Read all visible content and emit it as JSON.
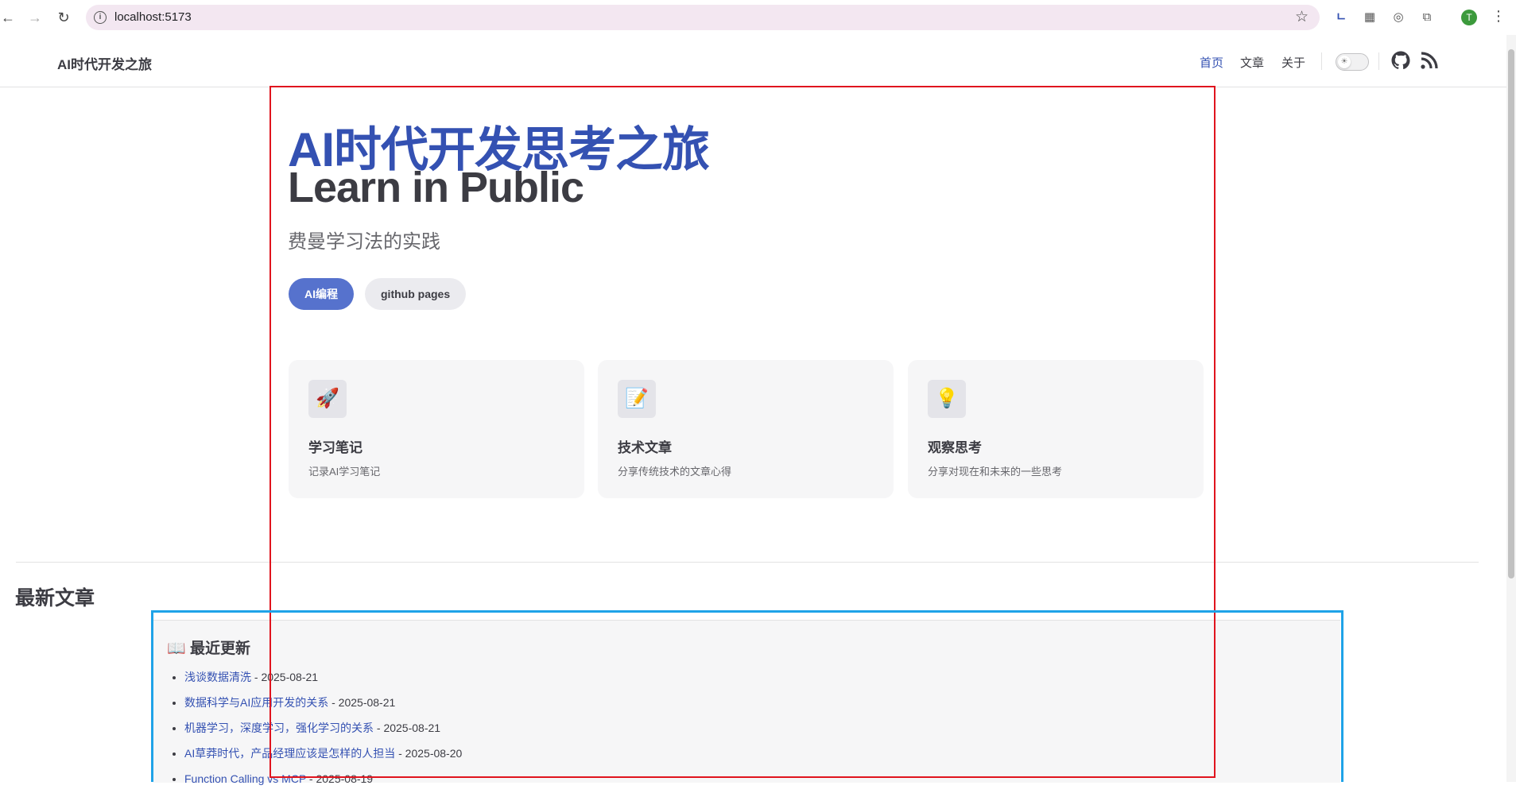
{
  "browser": {
    "url": "localhost:5173",
    "avatar_letter": "T"
  },
  "nav": {
    "brand": "AI时代开发之旅",
    "links": [
      {
        "label": "首页",
        "active": true
      },
      {
        "label": "文章",
        "active": false
      },
      {
        "label": "关于",
        "active": false
      }
    ],
    "social": [
      "github-icon",
      "rss-icon"
    ]
  },
  "hero": {
    "name": "AI时代开发思考之旅",
    "text": "Learn in Public",
    "tagline": "费曼学习法的实践",
    "actions": [
      {
        "label": "AI编程",
        "theme": "brand"
      },
      {
        "label": "github pages",
        "theme": "alt"
      }
    ]
  },
  "features": [
    {
      "icon": "🚀",
      "title": "学习笔记",
      "details": "记录AI学习笔记"
    },
    {
      "icon": "📝",
      "title": "技术文章",
      "details": "分享传统技术的文章心得"
    },
    {
      "icon": "💡",
      "title": "观察思考",
      "details": "分享对现在和未来的一些思考"
    }
  ],
  "latest": {
    "heading": "最新文章",
    "box_icon": "📖",
    "box_title": "最近更新",
    "items": [
      {
        "title": "浅谈数据清洗",
        "date": " - 2025-08-21"
      },
      {
        "title": "数据科学与AI应用开发的关系",
        "date": " - 2025-08-21"
      },
      {
        "title": "机器学习，深度学习，强化学习的关系",
        "date": " - 2025-08-21"
      },
      {
        "title": "AI草莽时代，产品经理应该是怎样的人担当",
        "date": " - 2025-08-20"
      },
      {
        "title": "Function Calling vs MCP",
        "date": " - 2025-08-19"
      }
    ]
  },
  "colors": {
    "brand": "#3451b2",
    "brand_button": "#5672cd",
    "annotation_red": "#e0141e",
    "annotation_blue": "#1fa3e8"
  }
}
